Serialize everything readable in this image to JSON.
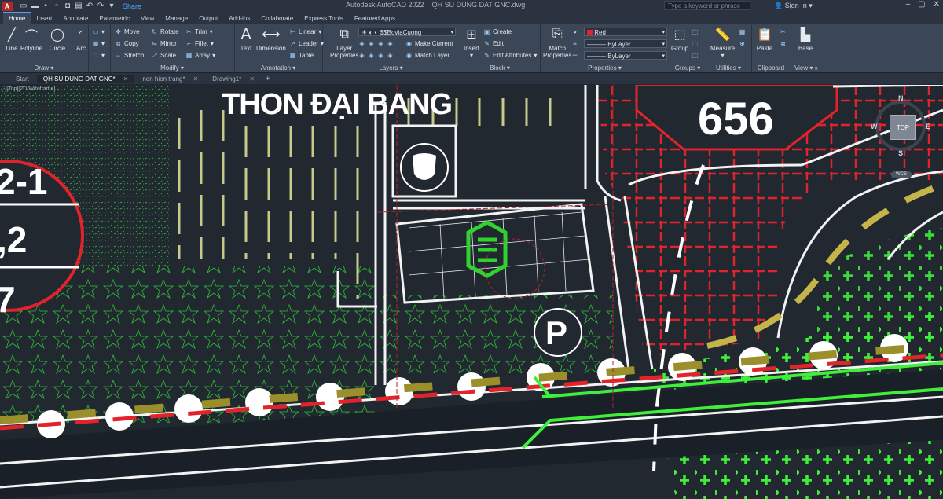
{
  "titlebar": {
    "logo": "A",
    "share": "Share",
    "app_title": "Autodesk AutoCAD 2022",
    "doc_title": "QH SU DUNG DAT GNC.dwg",
    "search_placeholder": "Type a keyword or phrase",
    "signin": "Sign In"
  },
  "ribbon_tabs": [
    "Home",
    "Insert",
    "Annotate",
    "Parametric",
    "View",
    "Manage",
    "Output",
    "Add-ins",
    "Collaborate",
    "Express Tools",
    "Featured Apps"
  ],
  "ribbon": {
    "draw": {
      "title": "Draw",
      "line": "Line",
      "polyline": "Polyline",
      "circle": "Circle",
      "arc": "Arc"
    },
    "modify": {
      "title": "Modify",
      "move": "Move",
      "rotate": "Rotate",
      "trim": "Trim",
      "copy": "Copy",
      "mirror": "Mirror",
      "fillet": "Fillet",
      "stretch": "Stretch",
      "scale": "Scale",
      "array": "Array"
    },
    "annotation": {
      "title": "Annotation",
      "text": "Text",
      "dimension": "Dimension",
      "linear": "Linear",
      "leader": "Leader",
      "table": "Table"
    },
    "layers": {
      "title": "Layers",
      "layer_properties_1": "Layer",
      "layer_properties_2": "Properties",
      "current_layer": "$$BoviaCuong",
      "make_current": "Make Current",
      "match_layer": "Match Layer"
    },
    "block": {
      "title": "Block",
      "insert": "Insert",
      "create": "Create",
      "edit": "Edit",
      "edit_attributes": "Edit Attributes"
    },
    "properties": {
      "title": "Properties",
      "match_1": "Match",
      "match_2": "Properties",
      "color": "Red",
      "linetype": "ByLayer",
      "lineweight": "ByLayer"
    },
    "groups": {
      "title": "Groups",
      "group": "Group"
    },
    "utilities": {
      "title": "Utilities",
      "measure": "Measure"
    },
    "clipboard": {
      "title": "Clipboard",
      "paste": "Paste"
    },
    "view": {
      "title": "View",
      "base": "Base"
    }
  },
  "doc_tabs": [
    {
      "label": "Start"
    },
    {
      "label": "QH SU DUNG DAT GNC*"
    },
    {
      "label": "nen hien trang*"
    },
    {
      "label": "Drawing1*"
    }
  ],
  "viewport": {
    "label": "[-][Top][2D Wireframe]",
    "place_name": "THON ĐẠI BANG",
    "lot_code": "656",
    "left_codes": [
      "2-1",
      ",2",
      "7"
    ],
    "parking_symbol": "P"
  },
  "navcube": {
    "n": "N",
    "s": "S",
    "e": "E",
    "w": "W",
    "top": "TOP",
    "wcs": "WCS"
  },
  "colors": {
    "accent": "#4ea3ff",
    "red_hatch": "#e3232b",
    "green_hatch": "#2fbf3a",
    "cross_green": "#3ef03a",
    "olive_lines": "#c5c98a"
  }
}
